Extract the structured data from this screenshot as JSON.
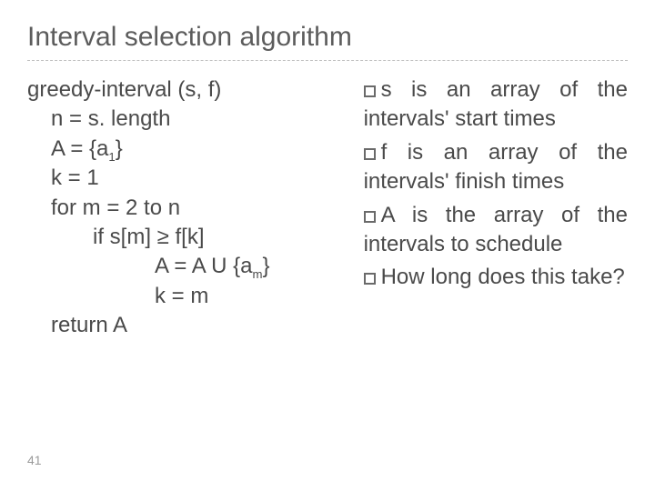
{
  "title": "Interval selection algorithm",
  "page_number": "41",
  "algo": {
    "header": "greedy-interval (s, f)",
    "l1": "n = s. length",
    "l2_pre": "A = {a",
    "l2_sub": "1",
    "l2_post": "}",
    "l3": "k = 1",
    "l4": "for m = 2 to n",
    "l5": "if s[m] ≥ f[k]",
    "l6_pre": "A = A U {a",
    "l6_sub": "m",
    "l6_post": "}",
    "l7": "k = m",
    "l8": "return A"
  },
  "notes": {
    "n1_lead": "s",
    "n1_rest": " is an array of the intervals' start times",
    "n2_lead": "f",
    "n2_rest": " is an array of the intervals' finish times",
    "n3_lead": "A",
    "n3_rest": " is the array of the intervals to schedule",
    "n4_lead": "How",
    "n4_rest": " long does this take?"
  }
}
